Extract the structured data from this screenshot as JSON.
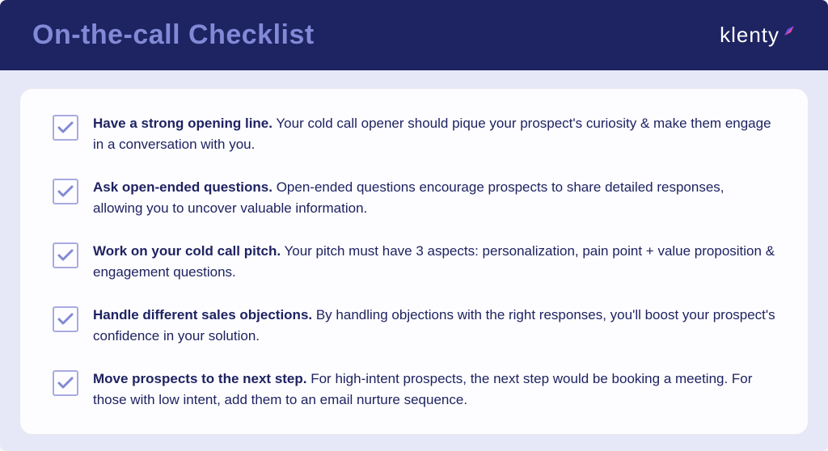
{
  "header": {
    "title": "On-the-call Checklist",
    "logo": "klenty"
  },
  "checklist": [
    {
      "title": "Have a strong opening line.",
      "description": " Your cold call opener should pique your prospect's curiosity & make them engage in a conversation with you."
    },
    {
      "title": "Ask open-ended questions.",
      "description": " Open-ended questions encourage prospects to share detailed responses, allowing you to uncover valuable information."
    },
    {
      "title": "Work on your cold call pitch.",
      "description": " Your pitch must have 3 aspects: personalization, pain point + value proposition & engagement questions."
    },
    {
      "title": "Handle different sales objections.",
      "description": "  By handling objections with the right responses, you'll boost your prospect's confidence in your solution."
    },
    {
      "title": "Move prospects to the next step.",
      "description": " For high-intent prospects, the next step would be booking a meeting. For those with low intent, add them to an email nurture sequence."
    }
  ]
}
